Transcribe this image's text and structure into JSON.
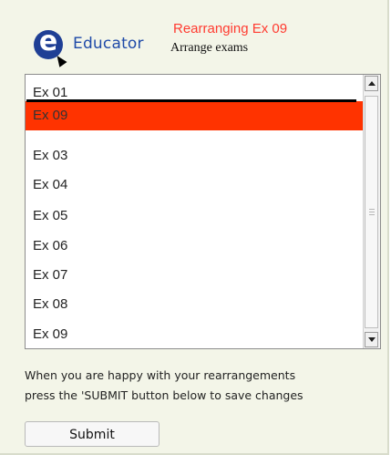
{
  "header": {
    "logo_letter": "e",
    "brand": "Educator",
    "title": "Rearranging Ex 09",
    "subtitle": "Arrange exams"
  },
  "list": {
    "items": [
      {
        "label": "Ex 01",
        "selected": false
      },
      {
        "label": "Ex 09",
        "selected": true
      },
      {
        "label": "Ex 03",
        "selected": false
      },
      {
        "label": "Ex 04",
        "selected": false
      },
      {
        "label": "Ex 05",
        "selected": false
      },
      {
        "label": "Ex 06",
        "selected": false
      },
      {
        "label": "Ex 07",
        "selected": false
      },
      {
        "label": "Ex 08",
        "selected": false
      },
      {
        "label": "Ex 09",
        "selected": false
      }
    ]
  },
  "instructions": {
    "line1": "When you are happy with your rearrangements",
    "line2": "press the 'SUBMIT button below to save changes"
  },
  "actions": {
    "submit_label": "Submit"
  },
  "colors": {
    "background": "#f3f5e8",
    "selected_row": "#ff3300",
    "title_red": "#ff3b30",
    "brand_blue": "#1f4aa8",
    "logo_blue": "#1f3f95"
  },
  "icons": [
    "educator-logo-icon",
    "cursor-icon",
    "scroll-up-arrow-icon",
    "scroll-down-arrow-icon"
  ]
}
